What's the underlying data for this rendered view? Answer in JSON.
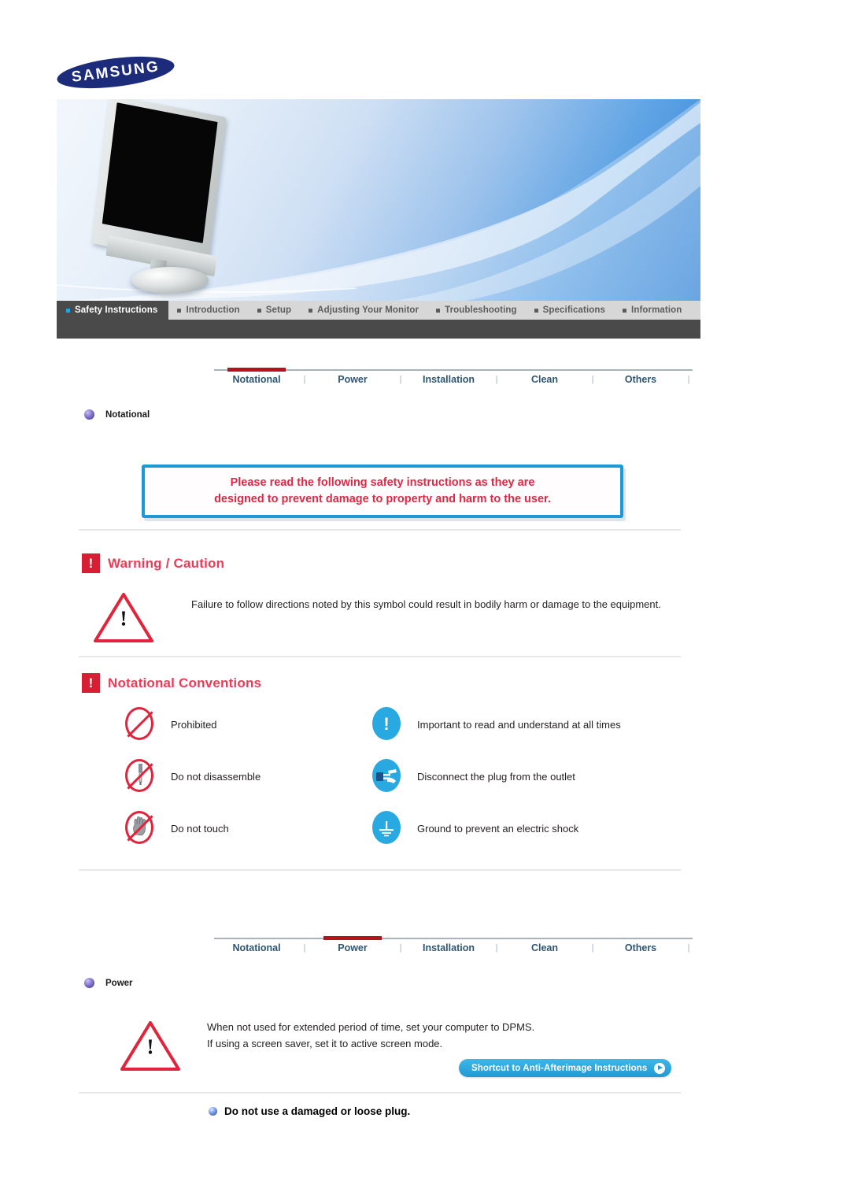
{
  "brand": {
    "logo_text": "SAMSUNG"
  },
  "hero": {
    "product_alt": "lcd-monitor"
  },
  "main_nav": {
    "items": [
      {
        "label": "Safety Instructions",
        "active": true
      },
      {
        "label": "Introduction",
        "active": false
      },
      {
        "label": "Setup",
        "active": false
      },
      {
        "label": "Adjusting Your Monitor",
        "active": false
      },
      {
        "label": "Troubleshooting",
        "active": false
      },
      {
        "label": "Specifications",
        "active": false
      },
      {
        "label": "Information",
        "active": false
      }
    ]
  },
  "tabs_top": {
    "items": [
      {
        "label": "Notational",
        "active": true
      },
      {
        "label": "Power",
        "active": false
      },
      {
        "label": "Installation",
        "active": false
      },
      {
        "label": "Clean",
        "active": false
      },
      {
        "label": "Others",
        "active": false
      }
    ],
    "separator": "|"
  },
  "tabs_bottom": {
    "items": [
      {
        "label": "Notational",
        "active": false
      },
      {
        "label": "Power",
        "active": true
      },
      {
        "label": "Installation",
        "active": false
      },
      {
        "label": "Clean",
        "active": false
      },
      {
        "label": "Others",
        "active": false
      }
    ],
    "separator": "|"
  },
  "section_notational": {
    "label": "Notational",
    "callout_line1": "Please read the following safety instructions as they are",
    "callout_line2": "designed to prevent damage to property and harm to the user.",
    "warning_heading": "Warning / Caution",
    "warning_mark": "!",
    "warning_text": "Failure to follow directions noted by this symbol could result in bodily harm or damage to the equipment.",
    "conventions_heading": "Notational Conventions",
    "conventions_mark": "!",
    "conventions": [
      {
        "icon": "prohibited-icon",
        "glyph": "",
        "label": "Prohibited",
        "style": "prohibit"
      },
      {
        "icon": "important-icon",
        "glyph": "!",
        "label": "Important to read and understand at all times",
        "style": "blue"
      },
      {
        "icon": "do-not-disassemble-icon",
        "glyph": "✂",
        "label": "Do not disassemble",
        "style": "prohibit"
      },
      {
        "icon": "disconnect-plug-icon",
        "glyph": "⚡",
        "label": "Disconnect the plug from the outlet",
        "style": "blue"
      },
      {
        "icon": "do-not-touch-icon",
        "glyph": "✋",
        "label": "Do not touch",
        "style": "prohibit"
      },
      {
        "icon": "ground-icon",
        "glyph": "⏚",
        "label": "Ground to prevent an electric shock",
        "style": "blue"
      }
    ]
  },
  "section_power": {
    "label": "Power",
    "warning_mark": "!",
    "text_line1": "When not used for extended period of time, set your computer to DPMS.",
    "text_line2": "If using a screen saver, set it to active screen mode.",
    "shortcut_label": "Shortcut to Anti-Afterimage Instructions",
    "heading": "Do not use a damaged or loose plug."
  },
  "colors": {
    "accent_red": "#d81e32",
    "heading_pink": "#ef3a56",
    "accent_blue": "#29a9e1",
    "tab_blue": "#2d5673",
    "nav_dark": "#4a4a4a",
    "nav_light": "#d7d7d7",
    "logo_navy": "#1c2b7a"
  }
}
